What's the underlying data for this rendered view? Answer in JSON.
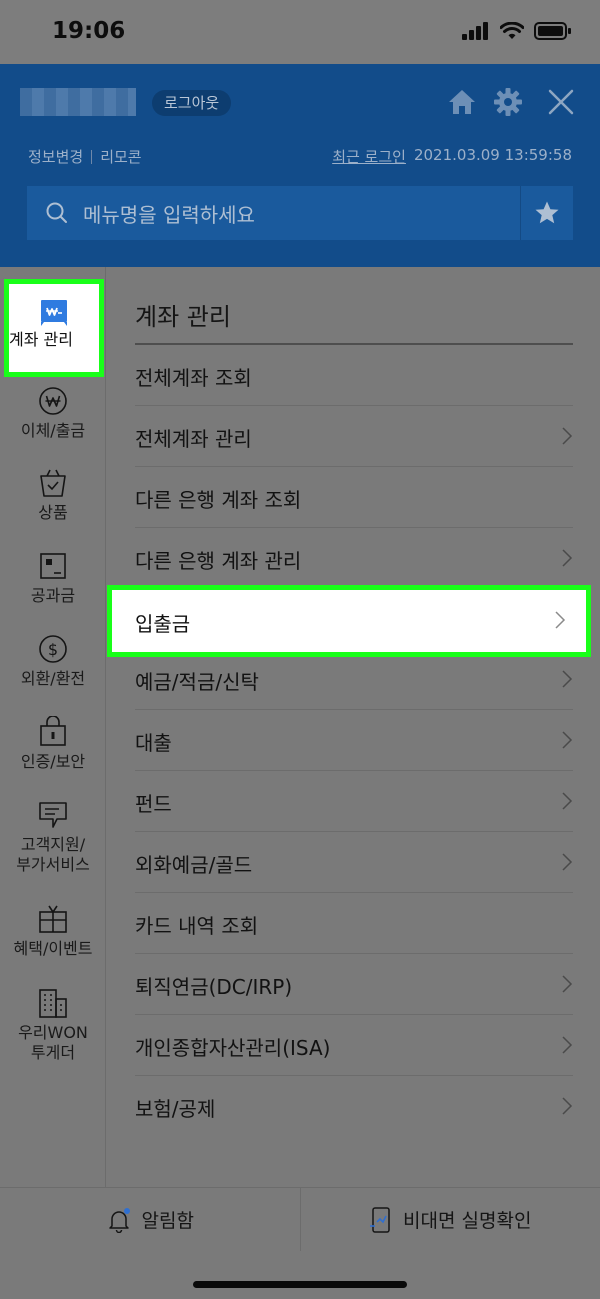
{
  "status_bar": {
    "time": "19:06"
  },
  "header": {
    "logout_label": "로그아웃",
    "links": [
      "정보변경",
      "리모콘"
    ],
    "recent_login_label": "최근 로그인",
    "recent_login_time": "2021.03.09 13:59:58",
    "search_placeholder": "메뉴명을 입력하세요"
  },
  "sidebar": {
    "items": [
      {
        "label": "계좌 관리",
        "icon": "account-wallet-icon",
        "active": true
      },
      {
        "label": "이체/출금",
        "icon": "won-circle-icon"
      },
      {
        "label": "상품",
        "icon": "shopping-bag-icon"
      },
      {
        "label": "공과금",
        "icon": "bill-icon"
      },
      {
        "label": "외환/환전",
        "icon": "dollar-circle-icon"
      },
      {
        "label": "인증/보안",
        "icon": "lock-icon"
      },
      {
        "label": "고객지원/\n부가서비스",
        "icon": "support-note-icon"
      },
      {
        "label": "혜택/이벤트",
        "icon": "gift-icon"
      },
      {
        "label": "우리WON\n투게더",
        "icon": "building-icon"
      }
    ]
  },
  "main": {
    "section_title": "계좌 관리",
    "items": [
      {
        "label": "전체계좌 조회",
        "has_arrow": false
      },
      {
        "label": "전체계좌 관리",
        "has_arrow": true
      },
      {
        "label": "다른 은행 계좌 조회",
        "has_arrow": false
      },
      {
        "label": "다른 은행 계좌 관리",
        "has_arrow": true
      },
      {
        "label": "입출금",
        "has_arrow": true,
        "highlighted": true
      },
      {
        "label": "예금/적금/신탁",
        "has_arrow": true
      },
      {
        "label": "대출",
        "has_arrow": true
      },
      {
        "label": "펀드",
        "has_arrow": true
      },
      {
        "label": "외화예금/골드",
        "has_arrow": true
      },
      {
        "label": "카드 내역 조회",
        "has_arrow": false
      },
      {
        "label": "퇴직연금(DC/IRP)",
        "has_arrow": true
      },
      {
        "label": "개인종합자산관리(ISA)",
        "has_arrow": true
      },
      {
        "label": "보험/공제",
        "has_arrow": true
      }
    ]
  },
  "bottom_bar": {
    "notification_label": "알림함",
    "verification_label": "비대면 실명확인"
  },
  "colors": {
    "header_blue": "#124c8a",
    "highlight_green": "#19ff19",
    "dim_overlay": "#7a7a7a"
  }
}
